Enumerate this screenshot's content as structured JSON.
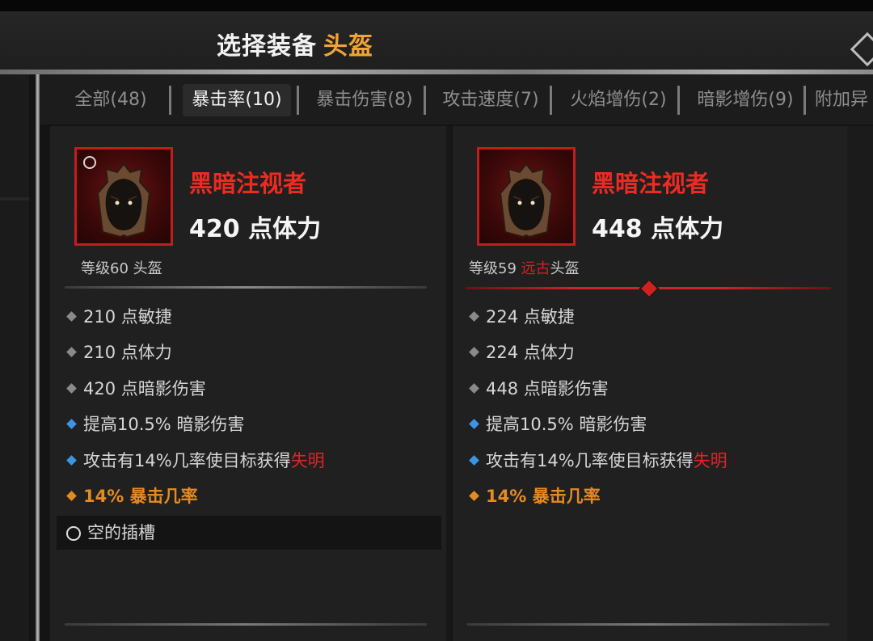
{
  "header": {
    "title": "选择装备",
    "slot": "头盔"
  },
  "tabs": [
    {
      "label": "全部(48)",
      "active": false
    },
    {
      "label": "暴击率(10)",
      "active": true
    },
    {
      "label": "暴击伤害(8)",
      "active": false
    },
    {
      "label": "攻击速度(7)",
      "active": false
    },
    {
      "label": "火焰增伤(2)",
      "active": false
    },
    {
      "label": "暗影增伤(9)",
      "active": false
    },
    {
      "label": "附加异",
      "active": false
    }
  ],
  "cards": [
    {
      "name": "黑暗注视者",
      "main_stat": "420 点体力",
      "level_prefix": "等级60 ",
      "rarity": "",
      "item_type": "头盔",
      "icon": "helm-icon",
      "affixes": [
        {
          "bullet": "gray",
          "text": "210 点敏捷"
        },
        {
          "bullet": "gray",
          "text": "210 点体力"
        },
        {
          "bullet": "gray",
          "text": "420 点暗影伤害"
        },
        {
          "bullet": "blue",
          "text": "提高10.5% 暗影伤害"
        },
        {
          "bullet": "blue",
          "text": "攻击有14%几率使目标获得",
          "highlight": "失明"
        },
        {
          "bullet": "orange",
          "text": "14% 暴击几率"
        }
      ],
      "socket": "空的插槽"
    },
    {
      "name": "黑暗注视者",
      "main_stat": "448 点体力",
      "level_prefix": "等级59 ",
      "rarity": "远古",
      "item_type": "头盔",
      "icon": "helm-icon",
      "affixes": [
        {
          "bullet": "gray",
          "text": "224 点敏捷"
        },
        {
          "bullet": "gray",
          "text": "224 点体力"
        },
        {
          "bullet": "gray",
          "text": "448 点暗影伤害"
        },
        {
          "bullet": "blue",
          "text": "提高10.5% 暗影伤害"
        },
        {
          "bullet": "blue",
          "text": "攻击有14%几率使目标获得",
          "highlight": "失明"
        },
        {
          "bullet": "orange",
          "text": "14% 暴击几率"
        }
      ]
    }
  ],
  "colors": {
    "accent": "#f0a435",
    "item_name": "#ee2a22",
    "legendary": "#e68a22",
    "magic": "#3c95e4"
  }
}
